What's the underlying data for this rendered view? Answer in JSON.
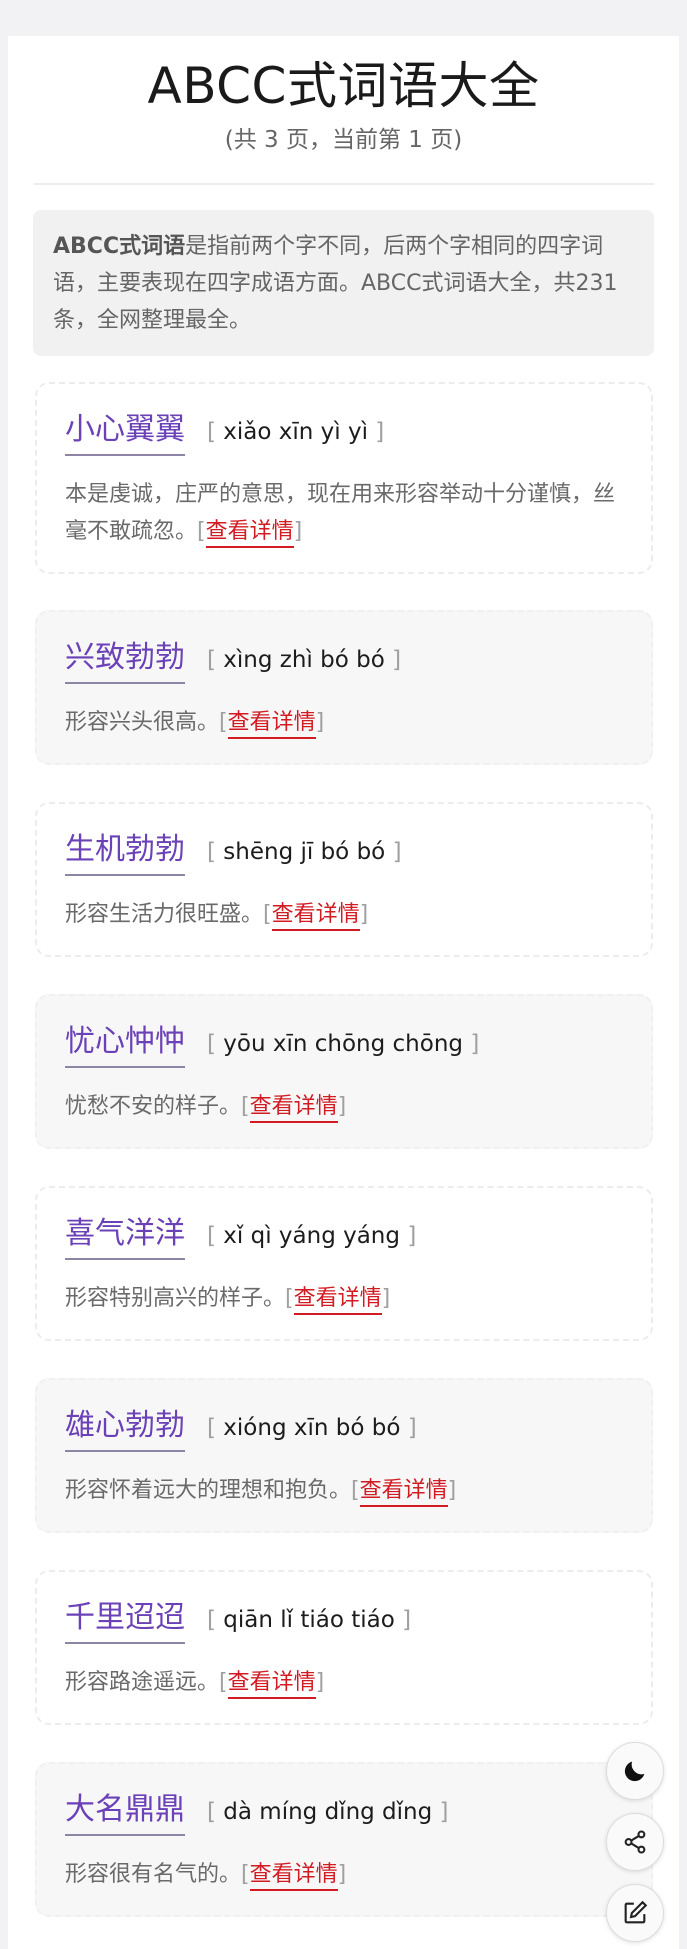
{
  "header": {
    "title": "ABCC式词语大全",
    "subtitle": "(共 3 页，当前第 1 页)"
  },
  "intro": {
    "bold": "ABCC式词语",
    "text": "是指前两个字不同，后两个字相同的四字词语，主要表现在四字成语方面。ABCC式词语大全，共231条，全网整理最全。"
  },
  "labels": {
    "bracket_open": "[",
    "bracket_close": "]",
    "detail_link": "查看详情"
  },
  "words": [
    {
      "word": "小心翼翼",
      "pinyin": "xiǎo xīn yì yì",
      "desc": "本是虔诚，庄严的意思，现在用来形容举动十分谨慎，丝毫不敢疏忽。"
    },
    {
      "word": "兴致勃勃",
      "pinyin": "xìng zhì bó bó",
      "desc": "形容兴头很高。"
    },
    {
      "word": "生机勃勃",
      "pinyin": "shēng jī bó bó",
      "desc": "形容生活力很旺盛。"
    },
    {
      "word": "忧心忡忡",
      "pinyin": "yōu xīn chōng chōng",
      "desc": "忧愁不安的样子。"
    },
    {
      "word": "喜气洋洋",
      "pinyin": "xǐ qì yáng yáng",
      "desc": "形容特别高兴的样子。"
    },
    {
      "word": "雄心勃勃",
      "pinyin": "xióng xīn bó bó",
      "desc": "形容怀着远大的理想和抱负。"
    },
    {
      "word": "千里迢迢",
      "pinyin": "qiān lǐ tiáo tiáo",
      "desc": "形容路途遥远。"
    },
    {
      "word": "大名鼎鼎",
      "pinyin": "dà míng dǐng dǐng",
      "desc": "形容很有名气的。"
    }
  ],
  "fab": {
    "icons": [
      "moon-icon",
      "share-icon",
      "edit-icon"
    ]
  },
  "colors": {
    "word": "#6b41b8",
    "link": "#d21c24",
    "background": "#f2f2f4"
  }
}
